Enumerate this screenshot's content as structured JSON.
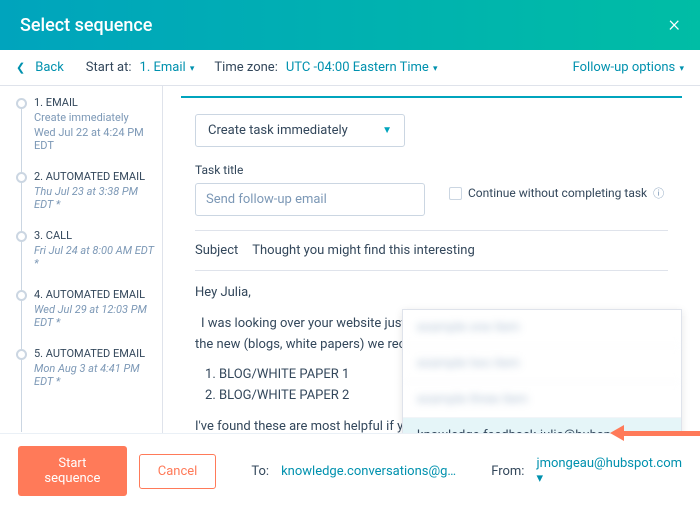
{
  "header": {
    "title": "Select sequence"
  },
  "toolbar": {
    "back": "Back",
    "start_at_label": "Start at:",
    "start_at_value": "1. Email",
    "tz_label": "Time zone:",
    "tz_value": "UTC -04:00 Eastern Time",
    "follow_up": "Follow-up options"
  },
  "sidebar": {
    "steps": [
      {
        "title": "1. EMAIL",
        "sub": "Create immediately",
        "sub2": "Wed Jul 22 at 4:24 PM EDT"
      },
      {
        "title": "2. AUTOMATED EMAIL",
        "sub": "Thu Jul 23 at 3:38 PM EDT *"
      },
      {
        "title": "3. CALL",
        "sub": "Fri Jul 24 at 8:00 AM EDT *"
      },
      {
        "title": "4. AUTOMATED EMAIL",
        "sub": "Wed Jul 29 at 12:03 PM EDT *"
      },
      {
        "title": "5. AUTOMATED EMAIL",
        "sub": "Mon Aug 3 at 4:41 PM EDT *"
      }
    ]
  },
  "main": {
    "create_task_dd": "Create task immediately",
    "task_title_label": "Task title",
    "task_title_value": "Send follow-up email",
    "continue_label": "Continue without completing task",
    "subject_label": "Subject",
    "subject_value": "Thought you might find this interesting",
    "body": {
      "greeting": "Hey Julia,",
      "p1": "I was looking over your website just now and thought you might enjoy some of the new (blogs, white papers) we recently developed for folks just like you:",
      "li1": "BLOG/WHITE PAPER 1",
      "li2": "BLOG/WHITE PAPER 2",
      "p2": "I've found these are most helpful if you're e"
    },
    "autocomplete": {
      "blurred": [
        "example one item",
        "example two item",
        "example three item"
      ],
      "selected": "knowledge-feedback-julia@hubspot.com"
    }
  },
  "footer": {
    "start": "Start sequence",
    "cancel": "Cancel",
    "to_label": "To:",
    "to_value": "knowledge.conversations@g…",
    "from_label": "From:",
    "from_value": "jmongeau@hubspot.com"
  }
}
